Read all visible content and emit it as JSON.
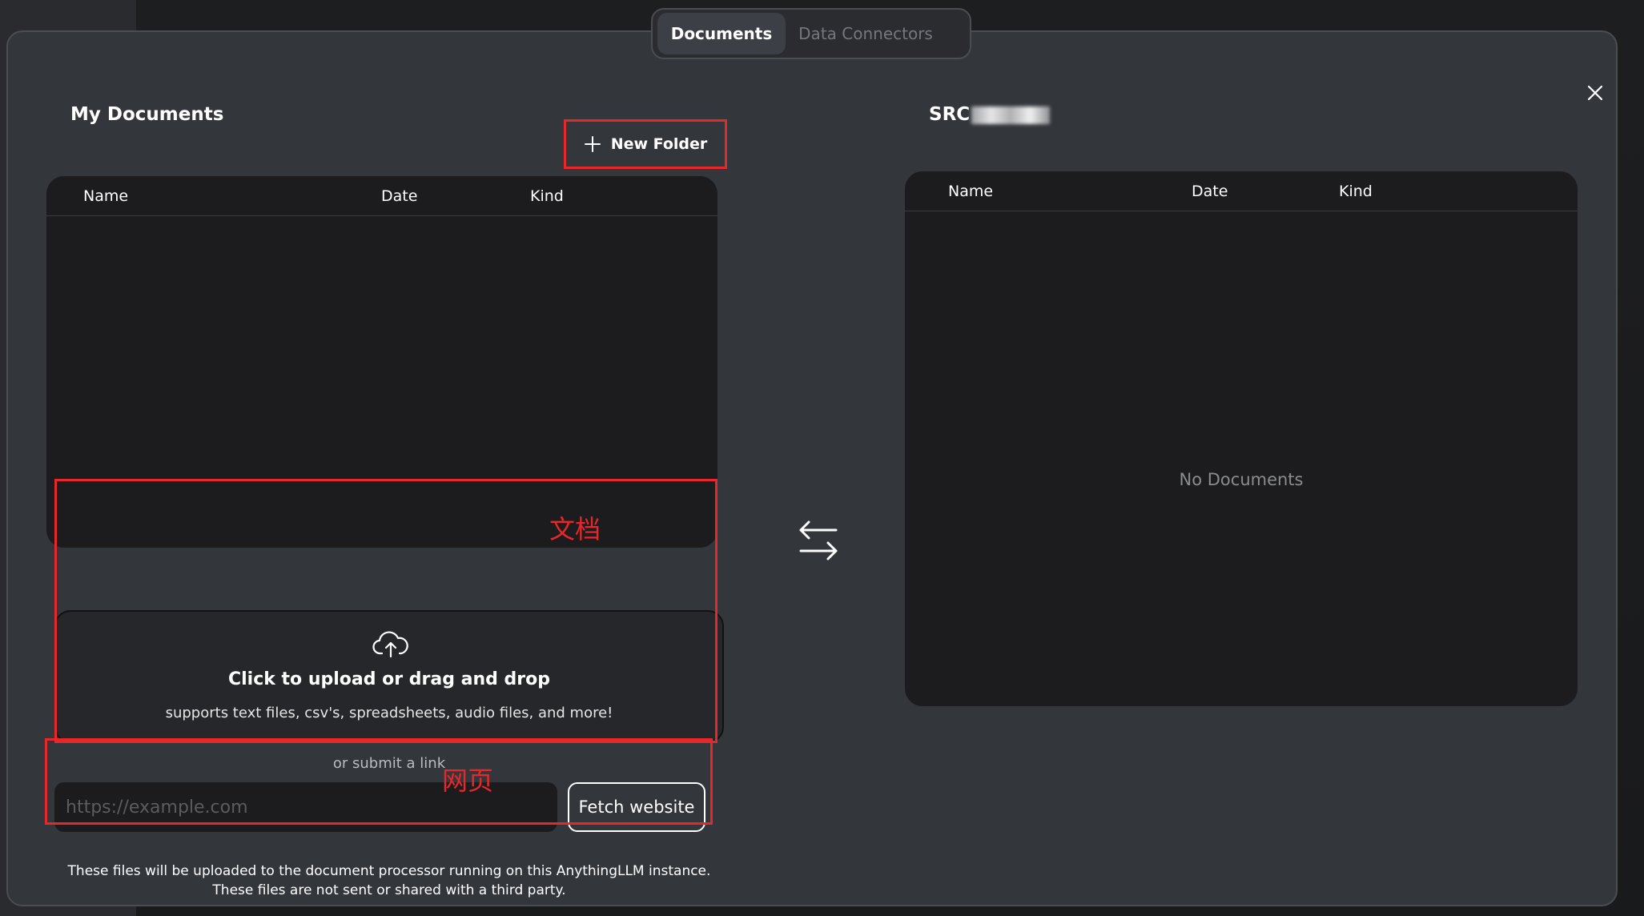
{
  "tabs": [
    {
      "label": "Documents",
      "active": true
    },
    {
      "label": "Data Connectors",
      "active": false
    }
  ],
  "left": {
    "title": "My Documents",
    "new_folder_label": "New Folder",
    "columns": [
      "Name",
      "Date",
      "Kind"
    ],
    "annotation_docs": "文档",
    "upload": {
      "title": "Click to upload or drag and drop",
      "subtitle": "supports text files, csv's, spreadsheets, audio files, and more!"
    },
    "submit_link_label": "or submit a link",
    "url_placeholder": "https://example.com",
    "annotation_web": "网页",
    "fetch_label": "Fetch website",
    "footer_line1": "These files will be uploaded to the document processor running on this AnythingLLM instance.",
    "footer_line2": "These files are not sent or shared with a third party."
  },
  "right": {
    "title_visible": "SRC",
    "columns": [
      "Name",
      "Date",
      "Kind"
    ],
    "empty_message": "No Documents"
  },
  "colors": {
    "annotation_red": "#e8272a",
    "modal_bg": "#33363b",
    "panel_bg": "#1c1c1e"
  },
  "icons": [
    "plus-icon",
    "close-icon",
    "cloud-upload-icon",
    "swap-arrows-icon"
  ]
}
